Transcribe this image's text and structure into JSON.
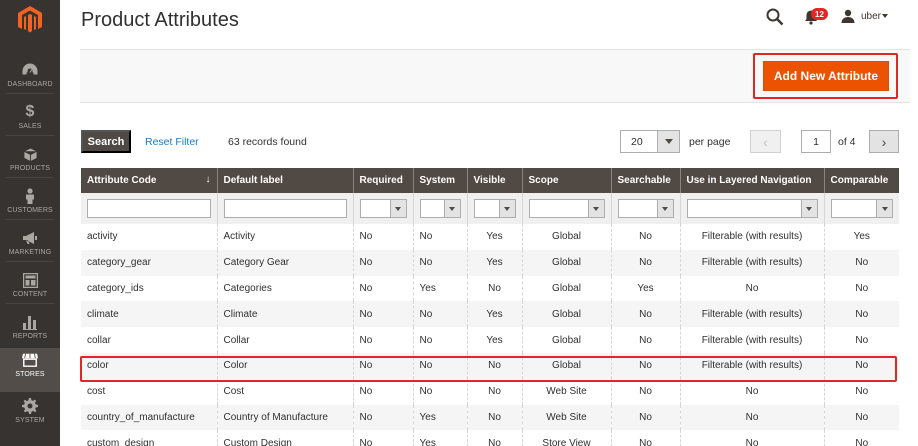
{
  "page": {
    "title": "Product Attributes"
  },
  "header": {
    "notification_count": "12",
    "user_name": "uber"
  },
  "sidebar": {
    "items": [
      {
        "label": "DASHBOARD",
        "icon": "dashboard-icon"
      },
      {
        "label": "SALES",
        "icon": "dollar-icon"
      },
      {
        "label": "PRODUCTS",
        "icon": "cube-icon"
      },
      {
        "label": "CUSTOMERS",
        "icon": "person-icon"
      },
      {
        "label": "MARKETING",
        "icon": "megaphone-icon"
      },
      {
        "label": "CONTENT",
        "icon": "layout-icon"
      },
      {
        "label": "REPORTS",
        "icon": "bar-chart-icon"
      },
      {
        "label": "STORES",
        "icon": "store-icon"
      },
      {
        "label": "SYSTEM",
        "icon": "gear-icon"
      }
    ],
    "active": "STORES"
  },
  "actions": {
    "add_label": "Add New Attribute"
  },
  "toolbar": {
    "search_label": "Search",
    "reset_label": "Reset Filter",
    "records_found": "63 records found",
    "per_page_value": "20",
    "per_page_label": "per page",
    "current_page": "1",
    "of_pages": "of 4"
  },
  "grid": {
    "columns": [
      "Attribute Code",
      "Default label",
      "Required",
      "System",
      "Visible",
      "Scope",
      "Searchable",
      "Use in Layered Navigation",
      "Comparable"
    ],
    "sort_indicator": "↓",
    "rows": [
      [
        "activity",
        "Activity",
        "No",
        "No",
        "Yes",
        "Global",
        "No",
        "Filterable (with results)",
        "Yes"
      ],
      [
        "category_gear",
        "Category Gear",
        "No",
        "No",
        "Yes",
        "Global",
        "No",
        "Filterable (with results)",
        "No"
      ],
      [
        "category_ids",
        "Categories",
        "No",
        "Yes",
        "No",
        "Global",
        "Yes",
        "No",
        "No"
      ],
      [
        "climate",
        "Climate",
        "No",
        "No",
        "Yes",
        "Global",
        "No",
        "Filterable (with results)",
        "No"
      ],
      [
        "collar",
        "Collar",
        "No",
        "No",
        "Yes",
        "Global",
        "No",
        "Filterable (with results)",
        "No"
      ],
      [
        "color",
        "Color",
        "No",
        "No",
        "No",
        "Global",
        "No",
        "Filterable (with results)",
        "No"
      ],
      [
        "cost",
        "Cost",
        "No",
        "No",
        "No",
        "Web Site",
        "No",
        "No",
        "No"
      ],
      [
        "country_of_manufacture",
        "Country of Manufacture",
        "No",
        "Yes",
        "No",
        "Web Site",
        "No",
        "No",
        "No"
      ],
      [
        "custom_design",
        "Custom Design",
        "No",
        "Yes",
        "No",
        "Store View",
        "No",
        "No",
        "No"
      ]
    ]
  },
  "colors": {
    "accent": "#eb5202",
    "highlight": "#e22626",
    "sidebar": "#373330",
    "header": "#514943"
  }
}
